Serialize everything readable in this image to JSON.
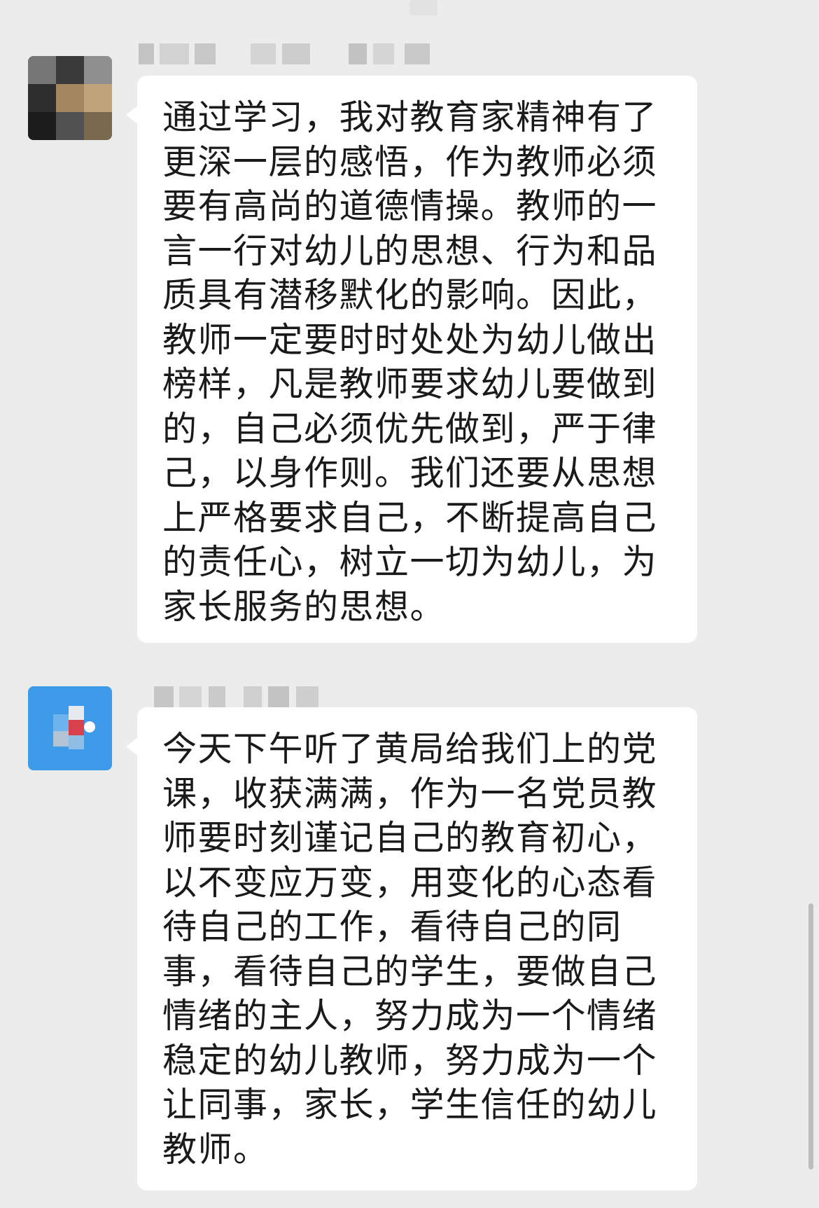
{
  "chat": {
    "messages": [
      {
        "sender_name": "",
        "avatar": "user-avatar-photo",
        "text": "通过学习，我对教育家精神有了更深一层的感悟，作为教师必须要有高尚的道德情操。教师的一言一行对幼儿的思想、行为和品质具有潜移默化的影响。因此，教师一定要时时处处为幼儿做出榜样，凡是教师要求幼儿要做到的，自己必须优先做到，严于律己，以身作则。我们还要从思想上严格要求自己，不断提高自己的责任心，树立一切为幼儿，为家长服务的思想。"
      },
      {
        "sender_name": "",
        "avatar": "user-avatar-blue",
        "text": "今天下午听了黄局给我们上的党课，收获满满，作为一名党员教师要时刻谨记自己的教育初心，以不变应万变，用变化的心态看待自己的工作，看待自己的同事，看待自己的学生，要做自己情绪的主人，努力成为一个情绪稳定的幼儿教师，努力成为一个让同事，家长，学生信任的幼儿教师。"
      }
    ]
  },
  "colors": {
    "background": "#ececec",
    "bubble": "#ffffff",
    "text": "#1a1a1a",
    "avatar_blue": "#3d9be9"
  }
}
